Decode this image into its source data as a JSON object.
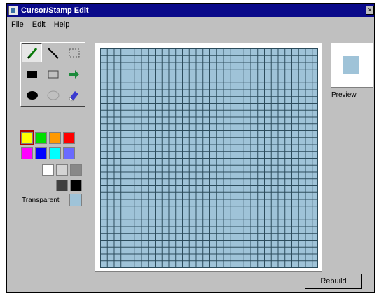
{
  "window": {
    "title": "Cursor/Stamp Edit",
    "close_glyph": "×"
  },
  "menu": [
    {
      "label": "File"
    },
    {
      "label": "Edit"
    },
    {
      "label": "Help"
    }
  ],
  "tools": [
    {
      "name": "pencil-icon",
      "active": true
    },
    {
      "name": "line-icon",
      "active": false
    },
    {
      "name": "selection-icon",
      "active": false
    },
    {
      "name": "filled-rectangle-icon",
      "active": false
    },
    {
      "name": "rectangle-icon",
      "active": false
    },
    {
      "name": "arrow-icon",
      "active": false
    },
    {
      "name": "filled-ellipse-icon",
      "active": false
    },
    {
      "name": "ellipse-icon",
      "active": false
    },
    {
      "name": "eraser-icon",
      "active": false
    }
  ],
  "palette": {
    "colors": [
      "#ffff00",
      "#00e000",
      "#ff9900",
      "#ff0000",
      "#ff00ff",
      "#0000ff",
      "#00ffff",
      "#6a6aff",
      "#ffffff",
      "#d4d4d4",
      "#888888",
      "#404040",
      "#000000"
    ],
    "selected_index": 0,
    "transparent_label": "Transparent",
    "transparent_color": "#9fc3d8"
  },
  "canvas": {
    "fill_color": "#9fc3d8",
    "grid_color": "#2a4a5a"
  },
  "preview": {
    "label": "Preview"
  },
  "buttons": {
    "rebuild_label": "Rebuild"
  }
}
